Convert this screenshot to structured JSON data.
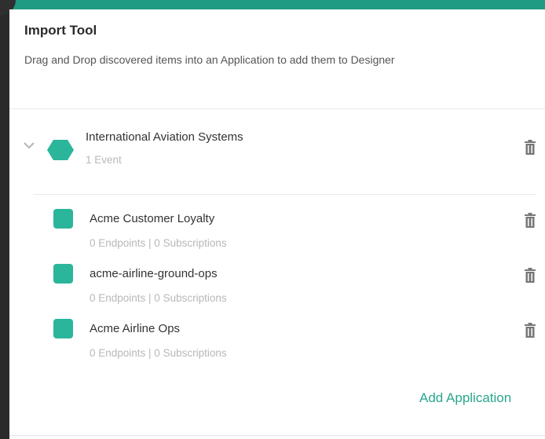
{
  "panel": {
    "title": "Import Tool",
    "subtitle": "Drag and Drop discovered items into an Application to add them to Designer"
  },
  "domain_group": {
    "name": "International Aviation Systems",
    "meta": "1 Event",
    "icon": "hexagon-icon",
    "color": "#2bb59a"
  },
  "applications": [
    {
      "name": "Acme Customer Loyalty",
      "meta": "0 Endpoints | 0 Subscriptions"
    },
    {
      "name": "acme-airline-ground-ops",
      "meta": "0 Endpoints | 0 Subscriptions"
    },
    {
      "name": "Acme Airline Ops",
      "meta": "0 Endpoints | 0 Subscriptions"
    }
  ],
  "actions": {
    "add_application": "Add Application"
  },
  "colors": {
    "accent": "#2bb59a",
    "link": "#2aa78d",
    "topbar": "#1f9a83"
  }
}
